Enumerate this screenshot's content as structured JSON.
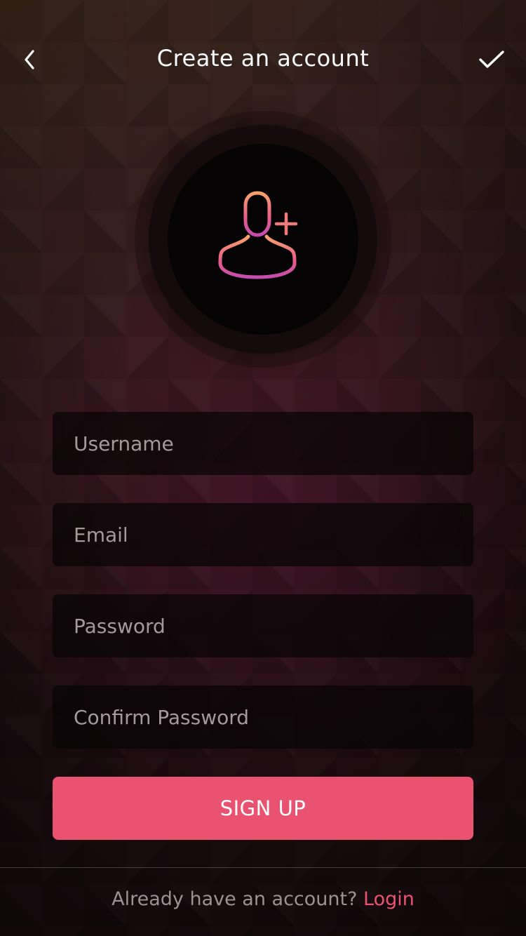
{
  "header": {
    "title": "Create an account",
    "back_icon": "chevron-left-icon",
    "confirm_icon": "checkmark-icon"
  },
  "avatar": {
    "icon": "add-user-icon",
    "gradient_top": "#f59e6e",
    "gradient_bottom": "#c94aa6"
  },
  "form": {
    "username_placeholder": "Username",
    "email_placeholder": "Email",
    "password_placeholder": "Password",
    "confirm_password_placeholder": "Confirm Password",
    "username_value": "",
    "email_value": "",
    "password_value": "",
    "confirm_password_value": ""
  },
  "signup_button": {
    "label": "SIGN UP",
    "color": "#e9536f"
  },
  "footer": {
    "prompt": "Already have an account?",
    "login_label": "Login",
    "accent": "#e9536f"
  }
}
